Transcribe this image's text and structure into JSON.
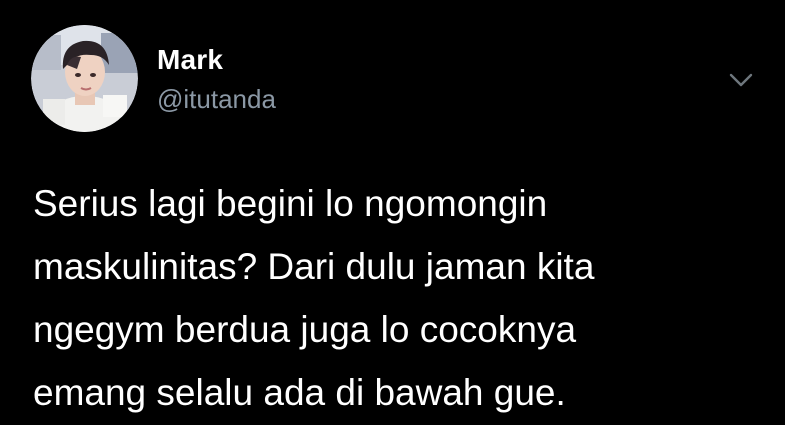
{
  "author": {
    "display_name": "Mark",
    "handle": "@itutanda",
    "avatar_icon": "profile-photo-avatar"
  },
  "tweet": {
    "lines": [
      "Serius lagi begini lo ngomongin",
      "maskulinitas? Dari dulu jaman kita",
      "ngegym berdua juga lo cocoknya",
      "emang selalu ada di bawah gue."
    ]
  },
  "menu": {
    "icon": "chevron-down-icon"
  },
  "colors": {
    "background": "#000000",
    "display_name": "#ffffff",
    "handle": "#8b98a5",
    "text": "#ffffff",
    "chevron": "#6e767d"
  }
}
